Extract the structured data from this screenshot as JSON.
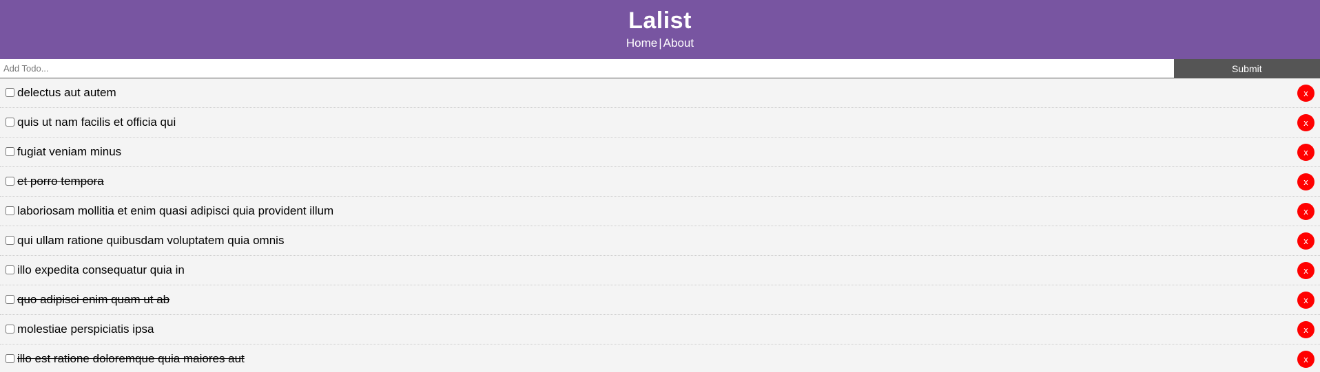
{
  "header": {
    "title": "Lalist",
    "nav": {
      "home": "Home",
      "separator": "|",
      "about": "About"
    }
  },
  "add_form": {
    "placeholder": "Add Todo...",
    "value": "",
    "submit_label": "Submit"
  },
  "todos": [
    {
      "title": "delectus aut autem",
      "completed": false
    },
    {
      "title": "quis ut nam facilis et officia qui",
      "completed": false
    },
    {
      "title": "fugiat veniam minus",
      "completed": false
    },
    {
      "title": "et porro tempora",
      "completed": true
    },
    {
      "title": "laboriosam mollitia et enim quasi adipisci quia provident illum",
      "completed": false
    },
    {
      "title": "qui ullam ratione quibusdam voluptatem quia omnis",
      "completed": false
    },
    {
      "title": "illo expedita consequatur quia in",
      "completed": false
    },
    {
      "title": "quo adipisci enim quam ut ab",
      "completed": true
    },
    {
      "title": "molestiae perspiciatis ipsa",
      "completed": false
    },
    {
      "title": "illo est ratione doloremque quia maiores aut",
      "completed": true
    }
  ],
  "delete_label": "x",
  "colors": {
    "header_bg": "#7855a1",
    "submit_bg": "#555555",
    "delete_bg": "#ff0000",
    "row_bg": "#f4f4f4"
  }
}
